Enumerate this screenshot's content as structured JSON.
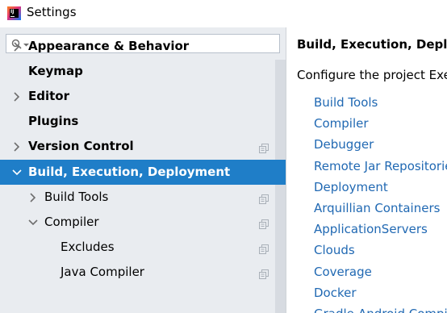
{
  "window": {
    "title": "Settings"
  },
  "search": {
    "placeholder": ""
  },
  "tree": [
    {
      "label": "Appearance & Behavior",
      "chevron": "right",
      "bold": true
    },
    {
      "label": "Keymap",
      "chevron": "none",
      "bold": true
    },
    {
      "label": "Editor",
      "chevron": "right",
      "bold": true
    },
    {
      "label": "Plugins",
      "chevron": "none",
      "bold": true
    },
    {
      "label": "Version Control",
      "chevron": "right",
      "bold": true,
      "copy_icon": true
    },
    {
      "label": "Build, Execution, Deployment",
      "chevron": "down",
      "bold": true,
      "selected": true
    },
    {
      "label": "Build Tools",
      "chevron": "right",
      "bold": false,
      "copy_icon": true
    },
    {
      "label": "Compiler",
      "chevron": "down",
      "bold": false,
      "copy_icon": true
    },
    {
      "label": "Excludes",
      "chevron": "none",
      "bold": false,
      "copy_icon": true
    },
    {
      "label": "Java Compiler",
      "chevron": "none",
      "bold": false,
      "copy_icon": true
    }
  ],
  "content": {
    "title": "Build, Execution, Deployment",
    "description": "Configure the project Execution",
    "links": [
      "Build Tools",
      "Compiler",
      "Debugger",
      "Remote Jar Repositories",
      "Deployment",
      "Arquillian Containers",
      "ApplicationServers",
      "Clouds",
      "Coverage",
      "Docker",
      "Gradle-Android Compiler"
    ]
  },
  "colors": {
    "selection": "#1f7ec8",
    "link": "#2169b3",
    "sidebar_bg": "#e9ecf0"
  }
}
